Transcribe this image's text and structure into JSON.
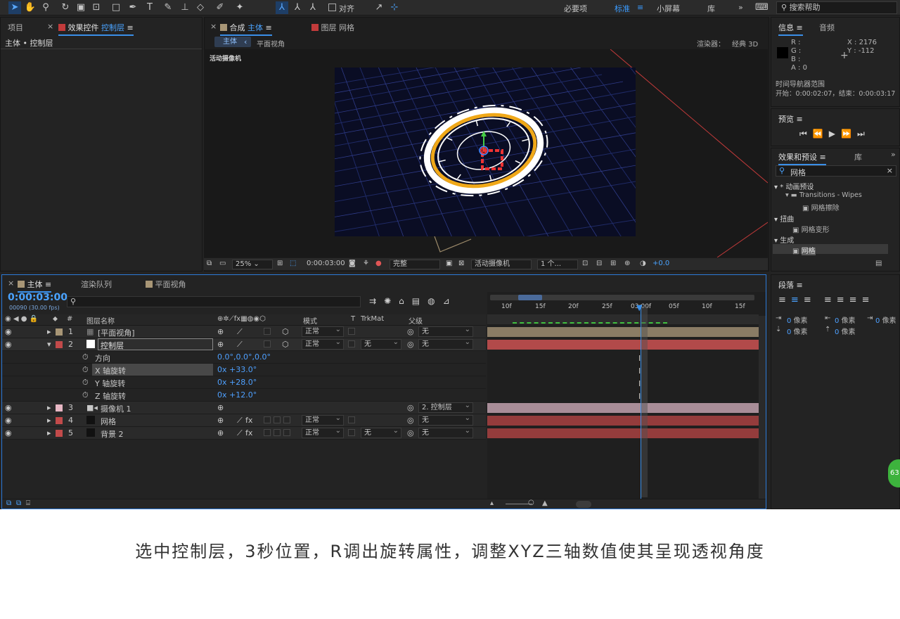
{
  "toolbar": {
    "align_label": "对齐",
    "workspaces": [
      "必要项",
      "标准",
      "小屏幕",
      "库"
    ],
    "search_help": "搜索帮助"
  },
  "project_panel": {
    "tab_project": "项目",
    "tab_effects_prefix": "效果控件",
    "tab_effects_layer": "控制层",
    "breadcrumb": "主体 • 控制层"
  },
  "comp_panel": {
    "tab_comp_prefix": "合成",
    "tab_comp_name": "主体",
    "tab_layer_prefix": "图层",
    "tab_layer_name": "网格",
    "sub_tab_main": "主体",
    "sub_tab_flat": "平面视角",
    "renderer_label": "渲染器：",
    "renderer_value": "经典 3D",
    "active_camera": "活动摄像机",
    "zoom": "25%",
    "timecode": "0:00:03:00",
    "resolution": "完整",
    "view_camera": "活动摄像机",
    "view_count": "1 个...",
    "exposure": "+0.0"
  },
  "info_panel": {
    "tab_info": "信息",
    "tab_audio": "音频",
    "r": "R :",
    "g": "G :",
    "b": "B :",
    "a": "A : 0",
    "x": "X : 2176",
    "y": "Y : -112",
    "range_title": "时间导航器范围",
    "range_value": "开始：0:00:02:07，结束：0:00:03:17"
  },
  "preview_panel": {
    "title": "预览"
  },
  "effects_panel": {
    "tab_effects": "效果和预设",
    "tab_library": "库",
    "search": "网格",
    "tree": [
      {
        "label": "* 动画预设",
        "level": 0
      },
      {
        "label": "Transitions - Wipes",
        "level": 1
      },
      {
        "label": "网格擦除",
        "level": 2
      },
      {
        "label": "扭曲",
        "level": 0
      },
      {
        "label": "网格变形",
        "level": 2
      },
      {
        "label": "生成",
        "level": 0
      },
      {
        "label": "网格",
        "level": 2
      }
    ]
  },
  "paragraph_panel": {
    "title": "段落",
    "unit": "0 像素"
  },
  "timeline": {
    "tab_main": "主体",
    "tab_render": "渲染队列",
    "tab_flat": "平面视角",
    "timecode": "0:00:03:00",
    "fps": "00090 (30.00 fps)",
    "search_placeholder": "",
    "header": {
      "num": "#",
      "name": "图层名称",
      "mode": "模式",
      "t": "T",
      "trkmat": "TrkMat",
      "parent": "父级"
    },
    "ruler": [
      "10f",
      "15f",
      "20f",
      "25f",
      "03:00f",
      "05f",
      "10f",
      "15f"
    ],
    "layers": [
      {
        "num": "1",
        "name": "[平面视角]",
        "color": "#a89676",
        "mode": "正常",
        "trkmat": "",
        "parent": "无"
      },
      {
        "num": "2",
        "name": "控制层",
        "color": "#c24a4a",
        "mode": "正常",
        "trkmat": "无",
        "parent": "无"
      },
      {
        "num": "3",
        "name": "摄像机 1",
        "color": "#e7b7c4",
        "mode": "",
        "trkmat": "",
        "parent": "2. 控制层"
      },
      {
        "num": "4",
        "name": "网格",
        "color": "#c24a4a",
        "mode": "正常",
        "trkmat": "",
        "parent": "无"
      },
      {
        "num": "5",
        "name": "背景 2",
        "color": "#c24a4a",
        "mode": "正常",
        "trkmat": "无",
        "parent": "无"
      }
    ],
    "props": [
      {
        "name": "方向",
        "value": "0.0°,0.0°,0.0°"
      },
      {
        "name": "X 轴旋转",
        "value": "0x +33.0°"
      },
      {
        "name": "Y 轴旋转",
        "value": "0x +28.0°"
      },
      {
        "name": "Z 轴旋转",
        "value": "0x +12.0°"
      }
    ]
  },
  "badge": "63",
  "caption": "选中控制层，3秒位置，R调出旋转属性，调整XYZ三轴数值使其呈现透视角度"
}
